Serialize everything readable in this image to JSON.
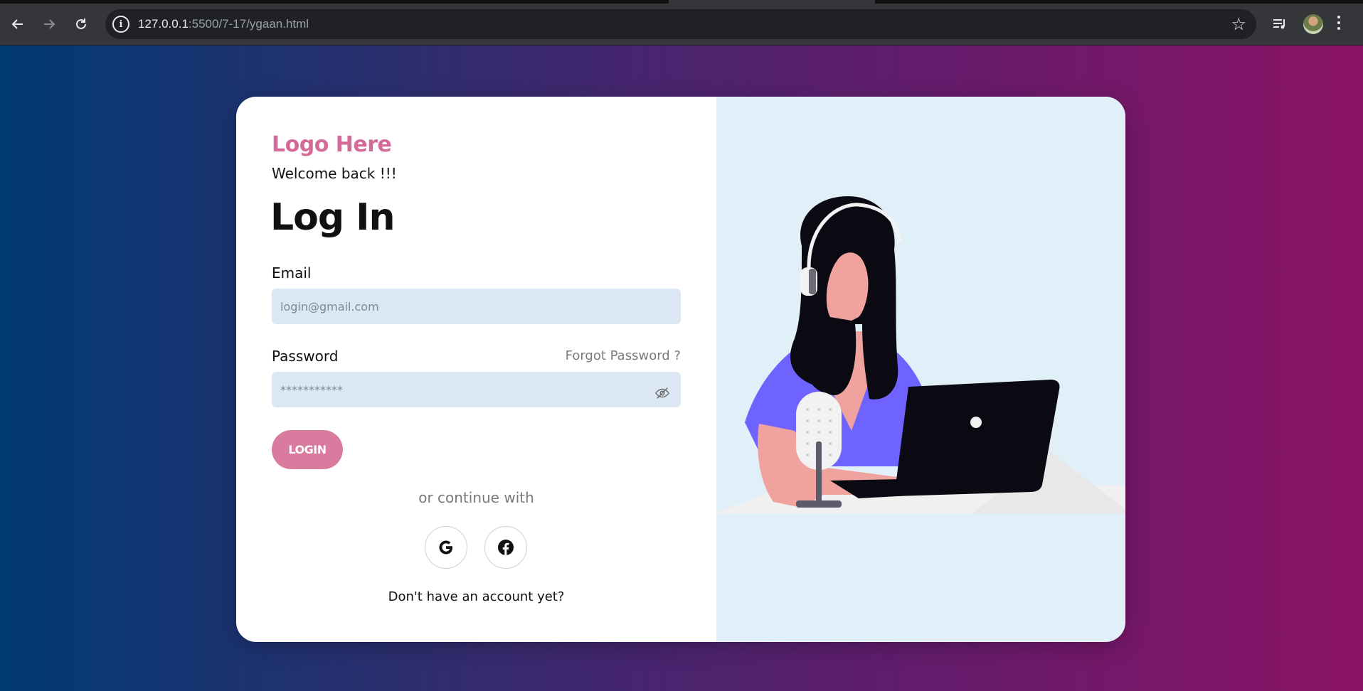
{
  "browser": {
    "url_host": "127.0.0.1",
    "url_rest": ":5500/7-17/ygaan.html",
    "nav": {
      "back_icon": "arrow-left-icon",
      "forward_icon": "arrow-right-icon",
      "reload_icon": "reload-icon"
    }
  },
  "login": {
    "logo": "Logo Here",
    "welcome": "Welcome back !!!",
    "title": "Log In",
    "email_label": "Email",
    "email_placeholder": "login@gmail.com",
    "password_label": "Password",
    "password_placeholder": "***********",
    "forgot_password": "Forgot Password ?",
    "login_button": "LOGIN",
    "continue_with": "or continue with",
    "social": [
      "google-icon",
      "facebook-icon"
    ],
    "signup_text": "Don't have an account yet?"
  },
  "colors": {
    "accent": "#d97b9f",
    "logo": "#d36a98",
    "input_bg": "#dbe8f4",
    "art_bg": "#e1eff9",
    "gradient_start": "#013a73",
    "gradient_end": "#8a1265"
  }
}
